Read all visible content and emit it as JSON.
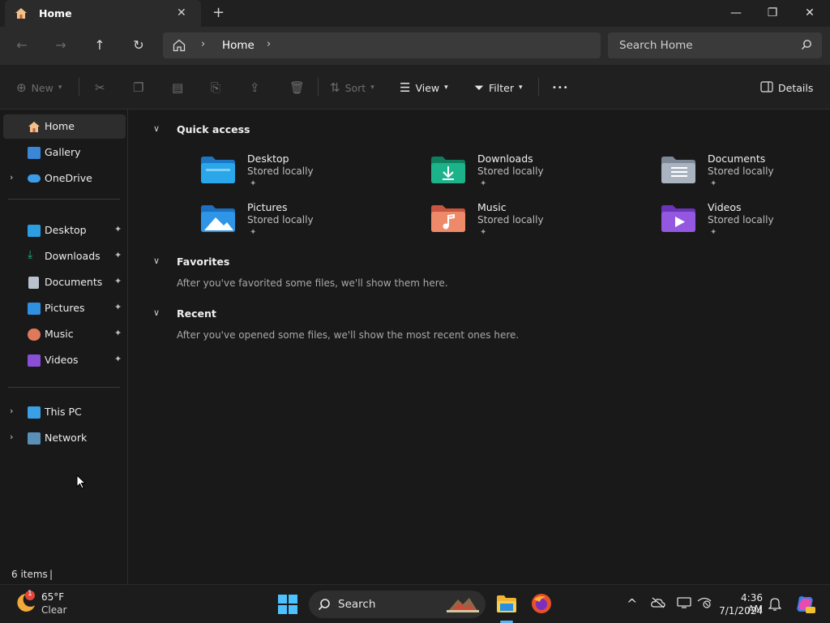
{
  "window": {
    "tab_title": "Home",
    "tab_close": "✕",
    "new_tab": "+",
    "minimize": "—",
    "maximize": "❐",
    "close": "✕"
  },
  "nav": {
    "back": "←",
    "forward": "→",
    "up": "↑",
    "refresh": "↻",
    "breadcrumb": "Home",
    "sep": "›",
    "search_placeholder": "Search Home"
  },
  "commands": {
    "new_label": "New",
    "sort_label": "Sort",
    "view_label": "View",
    "filter_label": "Filter",
    "more_label": "•••",
    "details_label": "Details"
  },
  "sidebar": {
    "items": [
      {
        "label": "Home"
      },
      {
        "label": "Gallery"
      },
      {
        "label": "OneDrive"
      },
      {
        "label": "Desktop"
      },
      {
        "label": "Downloads"
      },
      {
        "label": "Documents"
      },
      {
        "label": "Pictures"
      },
      {
        "label": "Music"
      },
      {
        "label": "Videos"
      },
      {
        "label": "This PC"
      },
      {
        "label": "Network"
      }
    ],
    "pin": "📌"
  },
  "sections": {
    "quick_access": "Quick access",
    "favorites": "Favorites",
    "favorites_msg": "After you've favorited some files, we'll show them here.",
    "recent": "Recent",
    "recent_msg": "After you've opened some files, we'll show the most recent ones here."
  },
  "quick_access": [
    {
      "name": "Desktop",
      "sub": "Stored locally",
      "color": "#2a9ee0"
    },
    {
      "name": "Downloads",
      "sub": "Stored locally",
      "color": "#1aa37a"
    },
    {
      "name": "Documents",
      "sub": "Stored locally",
      "color": "#9aa6b5"
    },
    {
      "name": "Pictures",
      "sub": "Stored locally",
      "color": "#2f8fe0"
    },
    {
      "name": "Music",
      "sub": "Stored locally",
      "color": "#e07a5a"
    },
    {
      "name": "Videos",
      "sub": "Stored locally",
      "color": "#8a4fd6"
    }
  ],
  "status": {
    "items_count": "6 items",
    "sep": "|"
  },
  "taskbar": {
    "weather_temp": "65°F",
    "weather_cond": "Clear",
    "weather_badge": "1",
    "search_label": "Search",
    "time": "4:36 AM",
    "date": "7/1/2024",
    "chevron": "^"
  }
}
